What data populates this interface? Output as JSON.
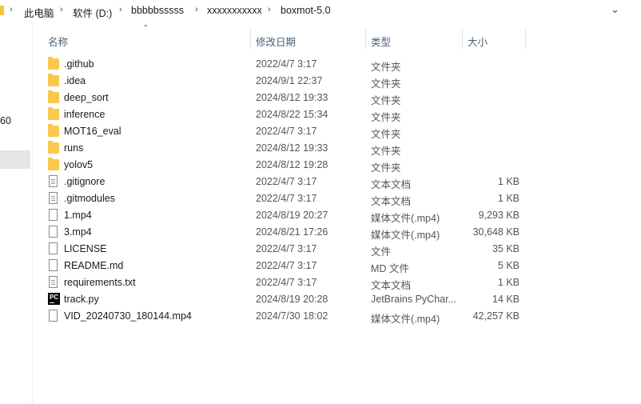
{
  "address_bar": {
    "crumbs": [
      "此电脑",
      "软件 (D:)",
      "bbbbbsssss",
      "xxxxxxxxxxx",
      "boxmot-5.0"
    ]
  },
  "left_panel": {
    "text": "60"
  },
  "columns": {
    "name": "名称",
    "modified": "修改日期",
    "type": "类型",
    "size": "大小"
  },
  "files": [
    {
      "name": ".github",
      "date": "2022/4/7 3:17",
      "type": "文件夹",
      "size": "",
      "icon": "folder-icon"
    },
    {
      "name": ".idea",
      "date": "2024/9/1 22:37",
      "type": "文件夹",
      "size": "",
      "icon": "folder-icon"
    },
    {
      "name": "deep_sort",
      "date": "2024/8/12 19:33",
      "type": "文件夹",
      "size": "",
      "icon": "folder-icon"
    },
    {
      "name": "inference",
      "date": "2024/8/22 15:34",
      "type": "文件夹",
      "size": "",
      "icon": "folder-icon"
    },
    {
      "name": "MOT16_eval",
      "date": "2022/4/7 3:17",
      "type": "文件夹",
      "size": "",
      "icon": "folder-icon"
    },
    {
      "name": "runs",
      "date": "2024/8/12 19:33",
      "type": "文件夹",
      "size": "",
      "icon": "folder-icon"
    },
    {
      "name": "yolov5",
      "date": "2024/8/12 19:28",
      "type": "文件夹",
      "size": "",
      "icon": "folder-icon"
    },
    {
      "name": ".gitignore",
      "date": "2022/4/7 3:17",
      "type": "文本文档",
      "size": "1 KB",
      "icon": "text-file-icon"
    },
    {
      "name": ".gitmodules",
      "date": "2022/4/7 3:17",
      "type": "文本文档",
      "size": "1 KB",
      "icon": "text-file-icon"
    },
    {
      "name": "1.mp4",
      "date": "2024/8/19 20:27",
      "type": "媒体文件(.mp4)",
      "size": "9,293 KB",
      "icon": "file-icon"
    },
    {
      "name": "3.mp4",
      "date": "2024/8/21 17:26",
      "type": "媒体文件(.mp4)",
      "size": "30,648 KB",
      "icon": "file-icon"
    },
    {
      "name": "LICENSE",
      "date": "2022/4/7 3:17",
      "type": "文件",
      "size": "35 KB",
      "icon": "file-icon"
    },
    {
      "name": "README.md",
      "date": "2022/4/7 3:17",
      "type": "MD 文件",
      "size": "5 KB",
      "icon": "file-icon"
    },
    {
      "name": "requirements.txt",
      "date": "2022/4/7 3:17",
      "type": "文本文档",
      "size": "1 KB",
      "icon": "text-file-icon"
    },
    {
      "name": "track.py",
      "date": "2024/8/19 20:28",
      "type": "JetBrains PyChar...",
      "size": "14 KB",
      "icon": "pycharm-icon"
    },
    {
      "name": "VID_20240730_180144.mp4",
      "date": "2024/7/30 18:02",
      "type": "媒体文件(.mp4)",
      "size": "42,257 KB",
      "icon": "file-icon"
    }
  ]
}
